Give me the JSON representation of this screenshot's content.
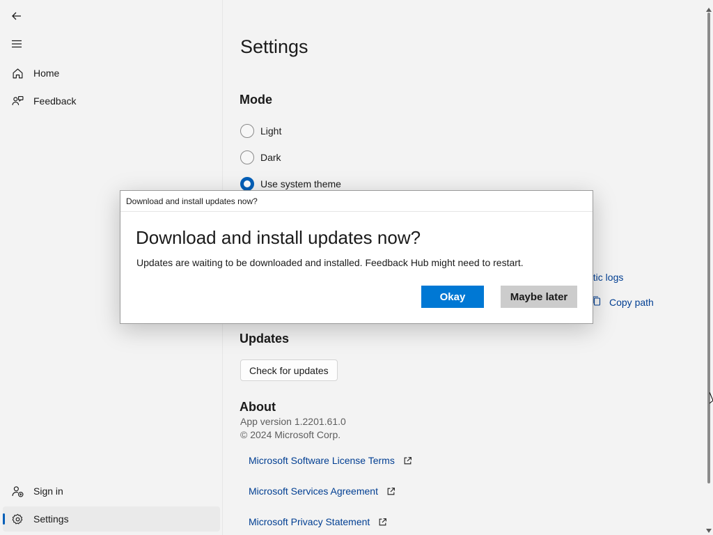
{
  "nav": {
    "back_icon": "back-arrow-icon",
    "menu_icon": "hamburger-menu-icon",
    "items": [
      {
        "label": "Home",
        "icon": "home-icon"
      },
      {
        "label": "Feedback",
        "icon": "feedback-icon"
      }
    ],
    "footer_items": [
      {
        "label": "Sign in",
        "icon": "sign-in-icon"
      },
      {
        "label": "Settings",
        "icon": "gear-icon",
        "selected": true
      }
    ]
  },
  "settings": {
    "title": "Settings",
    "mode": {
      "heading": "Mode",
      "options": [
        {
          "label": "Light",
          "selected": false
        },
        {
          "label": "Dark",
          "selected": false
        },
        {
          "label": "Use system theme",
          "selected": true
        }
      ]
    },
    "diagnostics": {
      "partial_link": "ostic logs",
      "copy_path_label": "Copy path"
    },
    "updates": {
      "heading": "Updates",
      "check_button": "Check for updates"
    },
    "about": {
      "heading": "About",
      "version": "App version 1.2201.61.0",
      "copyright": "© 2024 Microsoft Corp.",
      "links": [
        {
          "label": "Microsoft Software License Terms"
        },
        {
          "label": "Microsoft Services Agreement"
        },
        {
          "label": "Microsoft Privacy Statement"
        }
      ]
    }
  },
  "dialog": {
    "window_title": "Download and install updates now?",
    "heading": "Download and install updates now?",
    "message": "Updates are waiting to be downloaded and installed. Feedback Hub might need to restart.",
    "primary_button": "Okay",
    "secondary_button": "Maybe later"
  },
  "colors": {
    "accent": "#005fb8",
    "primary_button": "#0078d4",
    "link": "#003e92",
    "background": "#f3f3f3"
  }
}
